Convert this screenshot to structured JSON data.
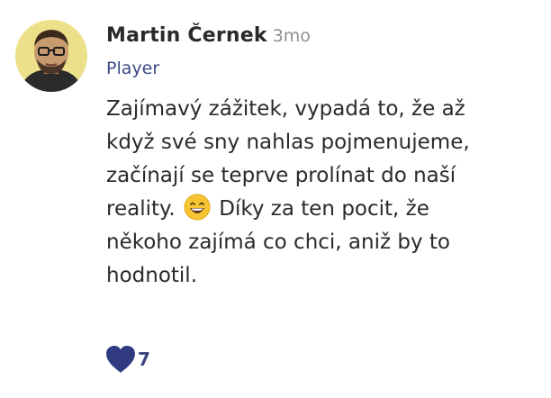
{
  "comment": {
    "author_name": "Martin Černek",
    "time_ago": "3mo",
    "role": "Player",
    "text_lines": [
      "Zajímavý zážitek, vypadá to, že až",
      "když své sny nahlas pojmenujeme,",
      "začínají se teprve prolínat do naší",
      "reality.",
      "Díky za ten pocit, že",
      "někoho zajímá co chci, aniž by to",
      "hodnotil."
    ],
    "emoji": "grinning-face-with-smiling-eyes",
    "like_count": "7",
    "colors": {
      "role": "#3e4a86",
      "heart": "#2f3a80",
      "avatar_bg": "#ece08a"
    }
  }
}
